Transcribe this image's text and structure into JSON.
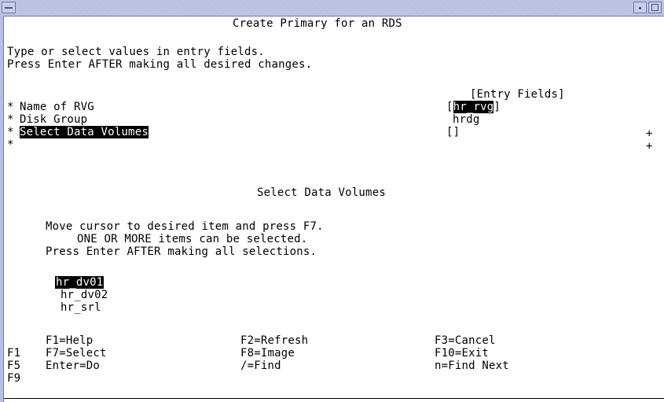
{
  "window": {
    "title": "Create Primary for an RDS"
  },
  "instructions": [
    "Type or select values in entry fields.",
    "Press Enter AFTER making all desired changes."
  ],
  "entry_fields_header": "[Entry Fields]",
  "fields": {
    "rvg": {
      "marker": "*",
      "label": "Name of RVG",
      "open": "[",
      "value": "hr_rvg",
      "close": "]"
    },
    "disk_group": {
      "marker": "*",
      "label": "Disk Group",
      "value": "hrdg"
    },
    "data_volumes": {
      "marker": "*",
      "label": "Select Data Volumes",
      "value": "[]",
      "plus": "+"
    },
    "blank": {
      "marker": "*",
      "plus": "+"
    }
  },
  "popup": {
    "title": "Select Data Volumes",
    "lines": [
      "Move cursor to desired item and press F7.",
      "ONE OR MORE items can be selected.",
      "Press Enter AFTER making all selections."
    ],
    "items": [
      "hr_dv01",
      "hr_dv02",
      "hr_srl"
    ],
    "selected_index": 0
  },
  "function_keys": {
    "col1": [
      "F1=Help",
      "F7=Select",
      "Enter=Do"
    ],
    "col2": [
      "F2=Refresh",
      "F8=Image",
      "/=Find"
    ],
    "col3": [
      "F3=Cancel",
      "F10=Exit",
      "n=Find Next"
    ],
    "side": [
      "F1",
      "F5",
      "F9"
    ]
  }
}
